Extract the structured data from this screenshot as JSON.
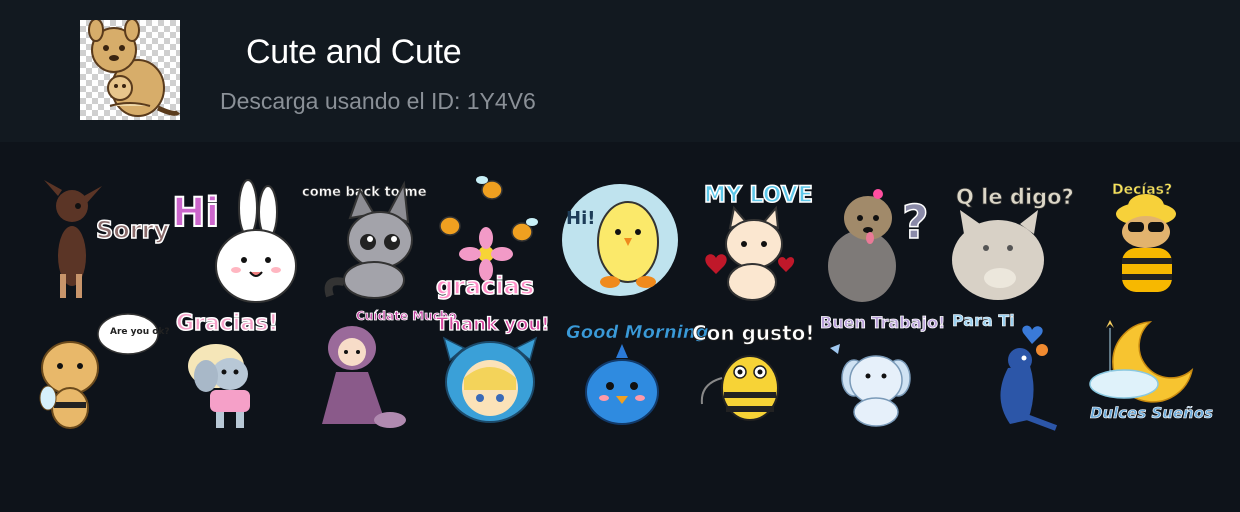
{
  "pack": {
    "title": "Cute and Cute",
    "download_text": "Descarga usando el ID: 1Y4V6",
    "thumbnail_icon": "kangaroo-icon"
  },
  "colors": {
    "background": "#0e131a",
    "header_background": "#121920",
    "title": "#ffffff",
    "subtitle": "#8a9097"
  },
  "stickers": [
    {
      "icon": "chihuahua-sorry-icon",
      "caption": "Sorry"
    },
    {
      "icon": "bunny-hi-icon",
      "caption": "Hi"
    },
    {
      "icon": "kitten-come-back-icon",
      "caption": "come back to me"
    },
    {
      "icon": "bees-gracias-icon",
      "caption": "gracias"
    },
    {
      "icon": "chick-hi-icon",
      "caption": "Hi!"
    },
    {
      "icon": "cat-my-love-icon",
      "caption": "MY LOVE"
    },
    {
      "icon": "yorkie-question-icon",
      "caption": "?"
    },
    {
      "icon": "cat-q-le-digo-icon",
      "caption": "Q le digo?"
    },
    {
      "icon": "dog-decias-icon",
      "caption": "Decías?"
    },
    {
      "icon": "bee-are-you-ok-icon",
      "caption": "Are you ok?"
    },
    {
      "icon": "elephant-gracias-icon",
      "caption": "Gracias!"
    },
    {
      "icon": "doll-cuidate-mucho-icon",
      "caption": "Cuídate Mucho"
    },
    {
      "icon": "girl-thank-you-icon",
      "caption": "Thank you!"
    },
    {
      "icon": "bird-good-morning-icon",
      "caption": "Good Morning"
    },
    {
      "icon": "bee-con-gusto-icon",
      "caption": "Con gusto!"
    },
    {
      "icon": "elephant-buen-trabajo-icon",
      "caption": "Buen Trabajo!"
    },
    {
      "icon": "macaw-para-ti-icon",
      "caption": "Para Ti"
    },
    {
      "icon": "moon-dulces-suenos-icon",
      "caption": "Dulces Sueños"
    }
  ]
}
